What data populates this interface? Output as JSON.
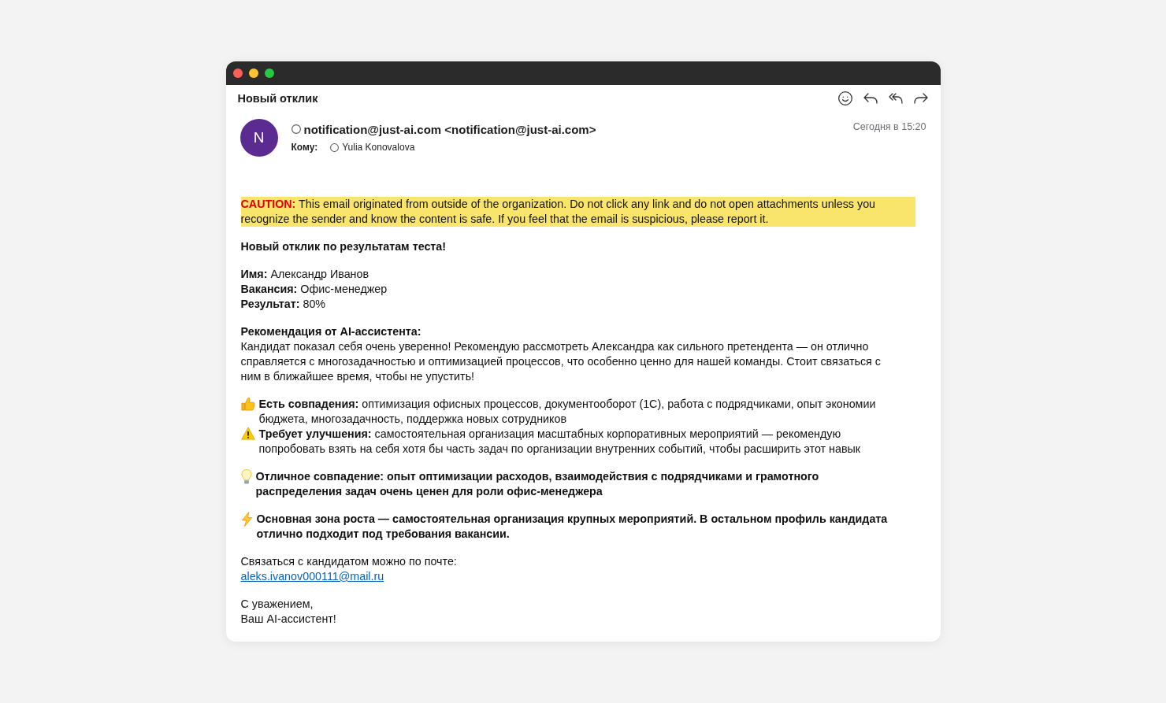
{
  "window": {
    "title": "Новый отклик"
  },
  "message": {
    "avatar_initial": "N",
    "sender": "notification@just-ai.com <notification@just-ai.com>",
    "to_label": "Кому:",
    "recipient": "Yulia Konovalova",
    "date": "Сегодня в 15:20"
  },
  "banner": {
    "text": "**CAUTION:** This email originated from outside of the organization. Do not click any link and do not open attachments unless you recognize the sender and know the content is safe. If you feel that the email is suspicious, please report it."
  },
  "body": {
    "paragraphs": [
      {
        "lines": [
          {
            "kind": "heading",
            "text": "Новый отклик по результатам теста!"
          }
        ]
      },
      {
        "lines": [
          {
            "kind": "plain",
            "text": "**Имя:** Александр Иванов"
          },
          {
            "kind": "plain",
            "text": "**Вакансия:** Офис-менеджер"
          },
          {
            "kind": "plain",
            "text": "**Результат:** 80%"
          }
        ]
      },
      {
        "lines": [
          {
            "kind": "heading",
            "text": "Рекомендация от AI-ассистента:"
          },
          {
            "kind": "plain",
            "text": "Кандидат показал себя очень уверенно! Рекомендую рассмотреть Александра как сильного претендента — он отлично справляется с многозадачностью и оптимизацией процессов, что особенно ценно для нашей команды. Стоит связаться с ним в ближайшее время, чтобы не упустить!"
          }
        ]
      },
      {
        "lines": [
          {
            "kind": "match",
            "text": "**Есть совпадения:** оптимизация офисных процессов, документооборот (1С), работа с подрядчиками, опыт экономии бюджета, многозадачность, поддержка новых сотрудников"
          },
          {
            "kind": "improve",
            "text": "**Требует улучшения:** самостоятельная организация масштабных корпоративных мероприятий — рекомендую попробовать взять на себя хотя бы часть задач по организации внутренних событий, чтобы расширить этот навык"
          }
        ]
      },
      {
        "lines": [
          {
            "kind": "insight",
            "text": "Отличное совпадение: опыт оптимизации расходов, взаимодействия с подрядчиками и грамотного распределения задач очень ценен для роли офис-менеджера"
          }
        ]
      },
      {
        "lines": [
          {
            "kind": "growth",
            "text": "Основная зона роста — самостоятельная организация крупных мероприятий. В остальном профиль кандидата отлично подходит под требования вакансии."
          }
        ]
      },
      {
        "lines": [
          {
            "kind": "plain",
            "text": "Связаться с кандидатом можно по почте:"
          },
          {
            "kind": "email",
            "text": "aleks.ivanov000111@mail.ru"
          }
        ]
      },
      {
        "lines": [
          {
            "kind": "plain",
            "text": "С уважением,"
          },
          {
            "kind": "plain",
            "text": "Ваш AI-ассистент!"
          }
        ]
      }
    ]
  }
}
